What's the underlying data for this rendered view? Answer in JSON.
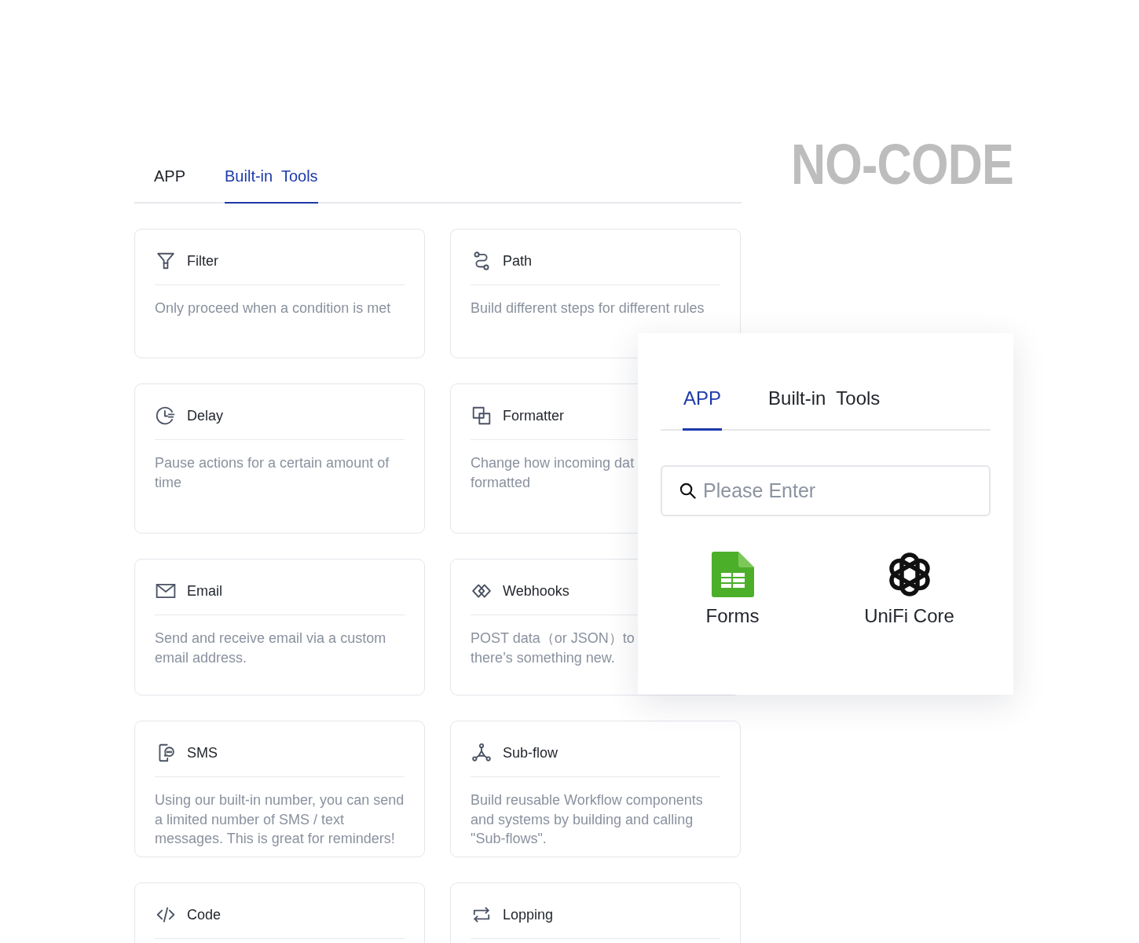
{
  "tabs": [
    {
      "label": "APP",
      "selected": false
    },
    {
      "label": "Built-in  Tools",
      "selected": true
    }
  ],
  "heading": "NO-CODE",
  "tools": [
    {
      "kind": "filter",
      "title": "Filter",
      "description": "Only proceed when a condition is met"
    },
    {
      "kind": "path",
      "title": "Path",
      "description": "Build different steps for different rules"
    },
    {
      "kind": "delay",
      "title": "Delay",
      "description": "Pause actions for a certain amount of time"
    },
    {
      "kind": "formatter",
      "title": "Formatter",
      "description": "Change how incoming dat\nformatted"
    },
    {
      "kind": "email",
      "title": "Email",
      "description": "Send and receive email via a custom email address."
    },
    {
      "kind": "webhooks",
      "title": "Webhooks",
      "description": "POST data（or JSON）to\nthere’s something new."
    },
    {
      "kind": "sms",
      "title": "SMS",
      "description": "Using our built-in number, you can send a limited number of SMS / text messages. This is great for reminders!"
    },
    {
      "kind": "subflow",
      "title": "Sub-flow",
      "description": "Build reusable Workflow components and systems by building and calling \"Sub-flows\"."
    },
    {
      "kind": "code",
      "title": "Code"
    },
    {
      "kind": "loop",
      "title": "Lopping"
    }
  ],
  "picker": {
    "tabs": [
      {
        "label": "APP",
        "selected": true
      },
      {
        "label": "Built-in  Tools",
        "selected": false
      }
    ],
    "search": {
      "placeholder": "Please Enter"
    },
    "apps": [
      {
        "kind": "forms",
        "name": "Forms"
      },
      {
        "kind": "unifi",
        "name": "UniFi Core"
      }
    ]
  }
}
